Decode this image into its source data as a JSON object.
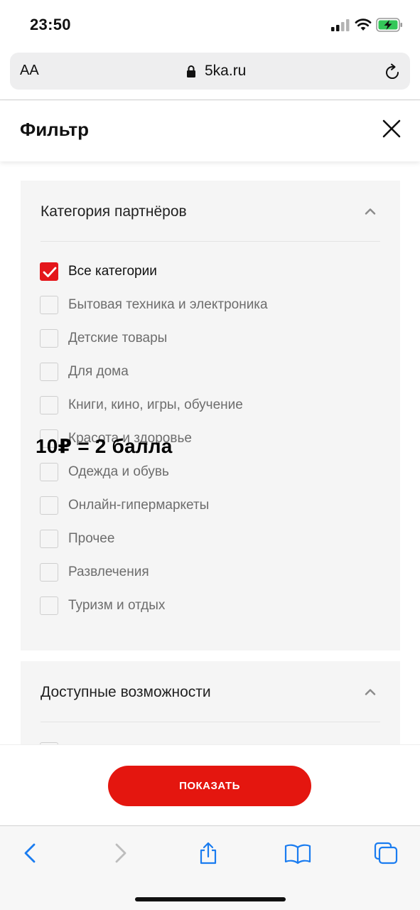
{
  "status_bar": {
    "time": "23:50",
    "icons": [
      "cellular-signal-icon",
      "wifi-icon",
      "battery-charging-icon"
    ]
  },
  "browser": {
    "text_size_label": "AA",
    "url": "5ka.ru",
    "icons": [
      "lock-icon",
      "reload-icon"
    ]
  },
  "filter": {
    "title": "Фильтр",
    "close_icon": "close-icon"
  },
  "partner_category": {
    "title": "Категория партнёров",
    "options": [
      {
        "label": "Все категории",
        "checked": true
      },
      {
        "label": "Бытовая техника и электроника",
        "checked": false
      },
      {
        "label": "Детские товары",
        "checked": false
      },
      {
        "label": "Для дома",
        "checked": false
      },
      {
        "label": "Книги, кино, игры, обучение",
        "checked": false
      },
      {
        "label": "Красота и здоровье",
        "checked": false
      },
      {
        "label": "Одежда и обувь",
        "checked": false
      },
      {
        "label": "Онлайн-гипермаркеты",
        "checked": false
      },
      {
        "label": "Прочее",
        "checked": false
      },
      {
        "label": "Развлечения",
        "checked": false
      },
      {
        "label": "Туризм и отдых",
        "checked": false
      }
    ]
  },
  "available_features": {
    "title": "Доступные возможности"
  },
  "overlay": {
    "text": "10₽ = 2 балла"
  },
  "actions": {
    "show_button": "ПОКАЗАТЬ"
  },
  "toolbar": {
    "icons": [
      "back-icon",
      "forward-icon",
      "share-icon",
      "bookmarks-icon",
      "tabs-icon"
    ]
  },
  "colors": {
    "accent": "#e4161b",
    "ios_blue": "#1a7cf0",
    "panel_bg": "#f5f5f5"
  }
}
